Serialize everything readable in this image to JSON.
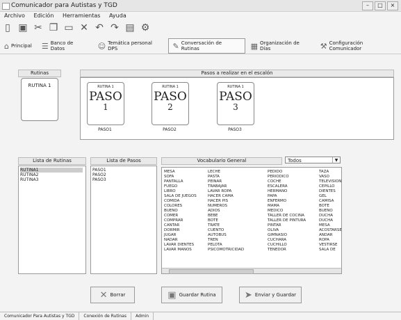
{
  "window": {
    "title": "Comunicador para Autistas y TGD"
  },
  "menu": [
    "Archivo",
    "Edición",
    "Herramientas",
    "Ayuda"
  ],
  "toolbar_icons": [
    "new-icon",
    "save-icon",
    "cut-icon",
    "copy-icon",
    "paste-icon",
    "delete-icon",
    "undo-icon",
    "redo-icon",
    "print-icon",
    "settings-icon"
  ],
  "tabs": [
    {
      "label": "Principal",
      "icon": "home-icon"
    },
    {
      "label": "Banco de Datos",
      "icon": "database-icon"
    },
    {
      "label": "Temática personal DPS",
      "icon": "person-icon"
    },
    {
      "label": "Conversación de Rutinas",
      "icon": "conversation-icon",
      "active": true
    },
    {
      "label": "Organización de Días",
      "icon": "calendar-icon"
    },
    {
      "label": "Configuración Comunicador",
      "icon": "config-icon"
    }
  ],
  "rutinas_section": {
    "header": "Rutinas",
    "card_label": "RUTINA 1"
  },
  "pasos_section": {
    "header": "Pasos a realizar en el escalón",
    "steps": [
      {
        "small": "RUTINA 1",
        "big": "PASO",
        "num": "1",
        "caption": "PASO1"
      },
      {
        "small": "RUTINA 1",
        "big": "PASO",
        "num": "2",
        "caption": "PASO2"
      },
      {
        "small": "RUTINA 1",
        "big": "PASO",
        "num": "3",
        "caption": "PASO3"
      }
    ]
  },
  "lista_rutinas": {
    "header": "Lista de Rutinas",
    "items": [
      "RUTINA1",
      "RUTINA2",
      "RUTINA3"
    ]
  },
  "lista_pasos": {
    "header": "Lista de Pasos",
    "items": [
      "PASO1",
      "PASO2",
      "PASO3"
    ]
  },
  "vocabulario": {
    "header": "Vocabulario General",
    "filter": "Todos",
    "columns": [
      [
        "MESA",
        "SOFA",
        "PANTALLA",
        "FUEGO",
        "LIBRO",
        "SALA DE JUEGOS",
        "COMIDA",
        "COLORES",
        "BUENO",
        "COMER",
        "COMPRAR",
        "CANTAR",
        "DORMIR",
        "JUGAR",
        "NADAR",
        "LAVAR DIENTES",
        "LAVAR MANOS"
      ],
      [
        "LECHE",
        "PASTA",
        "PEINAR",
        "TRABAJAR",
        "LAVAR ROPA",
        "HACER CAMA",
        "HACER PIS",
        "NUMEROS",
        "ADIOS",
        "BEBE",
        "BOTE",
        "TRATE",
        "CUENTO",
        "AUTOBUS",
        "TREN",
        "PELOTA",
        "PSICOMOTRICIDAD"
      ],
      [
        "PEDIDO",
        "PERIODICO",
        "COCHE",
        "ESCALERA",
        "HERMANO",
        "PAPA",
        "ENFERMO",
        "MAMA",
        "MEDICO",
        "TALLER DE COCINA",
        "TALLER DE PINTURA",
        "PINTAR",
        "OLIVA",
        "GIMNASIO",
        "CUCHARA",
        "CUCHILLO",
        "TENEDOR"
      ],
      [
        "TAZA",
        "VASO",
        "TELEVISION",
        "CEPILLO",
        "DIENTES",
        "GEL",
        "CAMISA",
        "BOTE",
        "BUENO",
        "DUCHA",
        "DUCHA",
        "MESA",
        "ACOSTARSE",
        "ANDAR",
        "ROPA",
        "VESTIRSE",
        "SALA DE"
      ]
    ]
  },
  "buttons": {
    "borrar": "Borrar",
    "guardar": "Guardar Rutina",
    "enviar": "Enviar y Guardar"
  },
  "status": [
    "Comunicador Para Autistas y TGD",
    "Conexión de Rutinas",
    "Admin"
  ]
}
